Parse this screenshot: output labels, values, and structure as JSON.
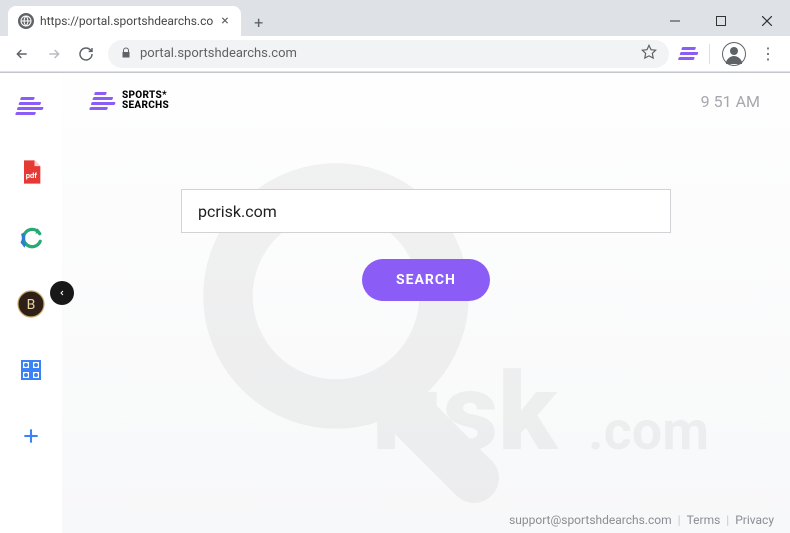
{
  "browser": {
    "tab_title": "https://portal.sportshdearchs.co",
    "url_display": "portal.sportshdearchs.com",
    "star_tooltip": "Bookmark"
  },
  "page": {
    "brand_line1": "SPORTS*",
    "brand_line2": "SEARCHS",
    "clock": "9 51 AM",
    "search_value": "pcrisk.com",
    "search_placeholder": "",
    "search_button": "SEARCH"
  },
  "footer": {
    "email": "support@sportshdearchs.com",
    "terms": "Terms",
    "privacy": "Privacy"
  },
  "colors": {
    "accent": "#8b5cf6"
  }
}
